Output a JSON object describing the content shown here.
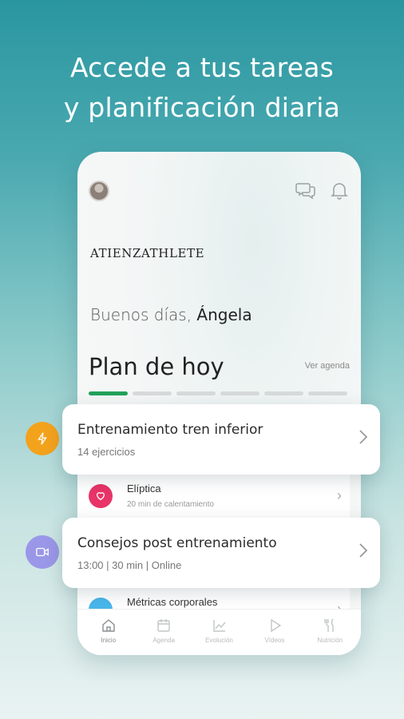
{
  "headline": {
    "line1": "Accede a tus tareas",
    "line2": "y planificación diaria"
  },
  "app": {
    "header": {
      "avatar_icon": "user-avatar",
      "chat_icon": "chat-bubbles-icon",
      "bell_icon": "bell-icon"
    },
    "logo_text": "ATIENZATHLETE",
    "greeting": {
      "prefix": "Buenos días,",
      "name": "Ángela"
    },
    "plan": {
      "title": "Plan de hoy",
      "agenda_link": "Ver agenda",
      "progress_total": 6,
      "progress_done": 1
    },
    "inner_rows": [
      {
        "title": "Elíptica",
        "subtitle": "20 min de calentamiento",
        "icon": "heart-icon",
        "color": "#e83468"
      },
      {
        "title": "Métricas corporales",
        "subtitle": "",
        "icon": "metrics-icon",
        "color": "#49b6ea"
      }
    ],
    "tabbar": [
      {
        "label": "Inicio",
        "icon": "home-icon",
        "active": true
      },
      {
        "label": "Agenda",
        "icon": "calendar-icon",
        "active": false
      },
      {
        "label": "Evolución",
        "icon": "chart-icon",
        "active": false
      },
      {
        "label": "Vídeos",
        "icon": "play-icon",
        "active": false
      },
      {
        "label": "Nutrición",
        "icon": "cutlery-icon",
        "active": false
      }
    ]
  },
  "floating_cards": [
    {
      "title": "Entrenamiento tren inferior",
      "subtitle": "14 ejercicios",
      "icon": "lightning-icon",
      "color": "#f3a21c"
    },
    {
      "title": "Consejos post entrenamiento",
      "subtitle": "13:00 | 30 min | Online",
      "icon": "video-icon",
      "color": "#9b97e8"
    }
  ],
  "colors": {
    "progress_done": "#22a25a",
    "progress_todo": "#d6dada"
  }
}
